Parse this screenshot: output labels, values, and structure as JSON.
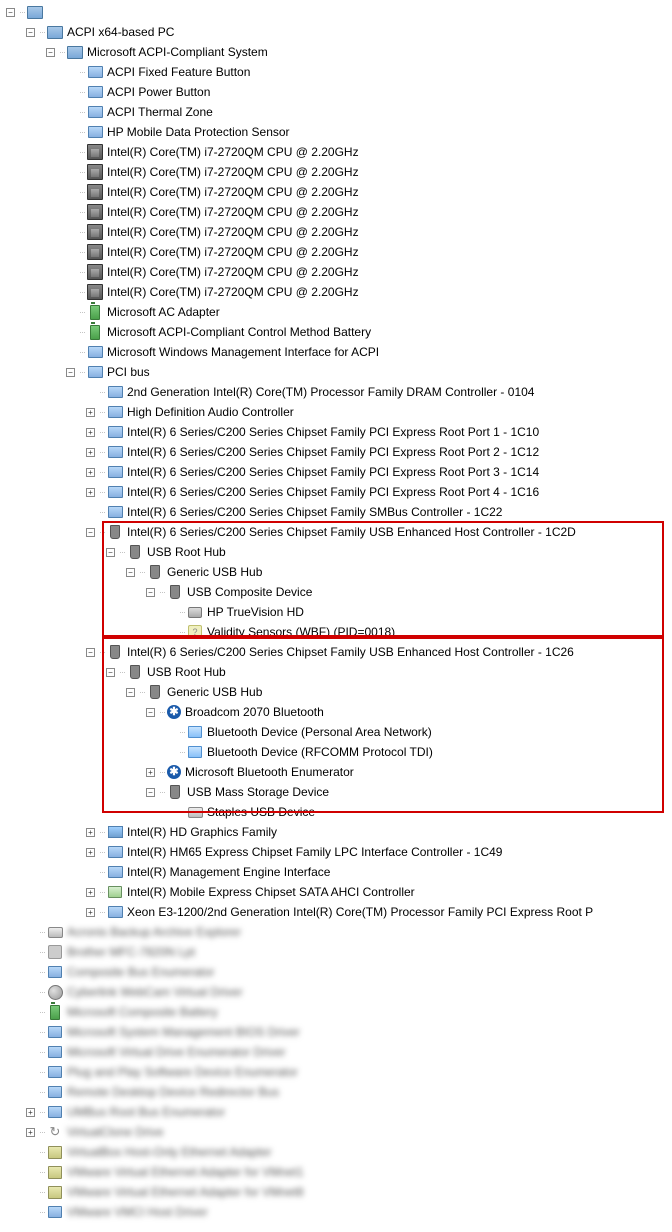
{
  "tree": [
    {
      "d": 0,
      "t": "minus",
      "i": "computer",
      "k": "root",
      "txt": "",
      "blur": true
    },
    {
      "d": 1,
      "t": "minus",
      "i": "computer",
      "k": "acpi-pc",
      "txt": "ACPI x64-based PC"
    },
    {
      "d": 2,
      "t": "minus",
      "i": "computer",
      "k": "ms-acpi",
      "txt": "Microsoft ACPI-Compliant System"
    },
    {
      "d": 3,
      "t": "",
      "i": "monitor",
      "k": "fixed-btn",
      "txt": "ACPI Fixed Feature Button"
    },
    {
      "d": 3,
      "t": "",
      "i": "monitor",
      "k": "power-btn",
      "txt": "ACPI Power Button"
    },
    {
      "d": 3,
      "t": "",
      "i": "monitor",
      "k": "thermal",
      "txt": "ACPI Thermal Zone"
    },
    {
      "d": 3,
      "t": "",
      "i": "monitor",
      "k": "hp-sensor",
      "txt": "HP Mobile Data Protection Sensor"
    },
    {
      "d": 3,
      "t": "",
      "i": "cpu",
      "k": "cpu0",
      "txt": "Intel(R) Core(TM) i7-2720QM CPU @ 2.20GHz"
    },
    {
      "d": 3,
      "t": "",
      "i": "cpu",
      "k": "cpu1",
      "txt": "Intel(R) Core(TM) i7-2720QM CPU @ 2.20GHz"
    },
    {
      "d": 3,
      "t": "",
      "i": "cpu",
      "k": "cpu2",
      "txt": "Intel(R) Core(TM) i7-2720QM CPU @ 2.20GHz"
    },
    {
      "d": 3,
      "t": "",
      "i": "cpu",
      "k": "cpu3",
      "txt": "Intel(R) Core(TM) i7-2720QM CPU @ 2.20GHz"
    },
    {
      "d": 3,
      "t": "",
      "i": "cpu",
      "k": "cpu4",
      "txt": "Intel(R) Core(TM) i7-2720QM CPU @ 2.20GHz"
    },
    {
      "d": 3,
      "t": "",
      "i": "cpu",
      "k": "cpu5",
      "txt": "Intel(R) Core(TM) i7-2720QM CPU @ 2.20GHz"
    },
    {
      "d": 3,
      "t": "",
      "i": "cpu",
      "k": "cpu6",
      "txt": "Intel(R) Core(TM) i7-2720QM CPU @ 2.20GHz"
    },
    {
      "d": 3,
      "t": "",
      "i": "cpu",
      "k": "cpu7",
      "txt": "Intel(R) Core(TM) i7-2720QM CPU @ 2.20GHz"
    },
    {
      "d": 3,
      "t": "",
      "i": "battery",
      "k": "ac-adapter",
      "txt": "Microsoft AC Adapter"
    },
    {
      "d": 3,
      "t": "",
      "i": "battery",
      "k": "ctrl-battery",
      "txt": "Microsoft ACPI-Compliant Control Method Battery"
    },
    {
      "d": 3,
      "t": "",
      "i": "monitor",
      "k": "wmi-acpi",
      "txt": "Microsoft Windows Management Interface for ACPI"
    },
    {
      "d": 3,
      "t": "minus",
      "i": "monitor",
      "k": "pci-bus",
      "txt": "PCI bus"
    },
    {
      "d": 4,
      "t": "",
      "i": "monitor",
      "k": "dram",
      "txt": "2nd Generation Intel(R) Core(TM) Processor Family DRAM Controller - 0104"
    },
    {
      "d": 4,
      "t": "plus",
      "i": "monitor",
      "k": "hd-audio",
      "txt": "High Definition Audio Controller"
    },
    {
      "d": 4,
      "t": "plus",
      "i": "monitor",
      "k": "pci-1",
      "txt": "Intel(R) 6 Series/C200 Series Chipset Family PCI Express Root Port 1 - 1C10"
    },
    {
      "d": 4,
      "t": "plus",
      "i": "monitor",
      "k": "pci-2",
      "txt": "Intel(R) 6 Series/C200 Series Chipset Family PCI Express Root Port 2 - 1C12"
    },
    {
      "d": 4,
      "t": "plus",
      "i": "monitor",
      "k": "pci-3",
      "txt": "Intel(R) 6 Series/C200 Series Chipset Family PCI Express Root Port 3 - 1C14"
    },
    {
      "d": 4,
      "t": "plus",
      "i": "monitor",
      "k": "pci-4",
      "txt": "Intel(R) 6 Series/C200 Series Chipset Family PCI Express Root Port 4 - 1C16"
    },
    {
      "d": 4,
      "t": "",
      "i": "monitor",
      "k": "smbus",
      "txt": "Intel(R) 6 Series/C200 Series Chipset Family SMBus Controller - 1C22"
    },
    {
      "d": 4,
      "t": "minus",
      "i": "usb",
      "k": "usb-host-1c2d",
      "txt": "Intel(R) 6 Series/C200 Series Chipset Family USB Enhanced Host Controller - 1C2D"
    },
    {
      "d": 5,
      "t": "minus",
      "i": "usb",
      "k": "usb-root-1",
      "txt": "USB Root Hub"
    },
    {
      "d": 6,
      "t": "minus",
      "i": "usb",
      "k": "generic-hub-1",
      "txt": "Generic USB Hub"
    },
    {
      "d": 7,
      "t": "minus",
      "i": "usb",
      "k": "usb-composite",
      "txt": "USB Composite Device"
    },
    {
      "d": 8,
      "t": "",
      "i": "cam",
      "k": "truevision",
      "txt": "HP TrueVision HD"
    },
    {
      "d": 8,
      "t": "",
      "i": "unknown",
      "k": "validity",
      "txt": "Validity Sensors (WBF) (PID=0018)"
    },
    {
      "d": 4,
      "t": "minus",
      "i": "usb",
      "k": "usb-host-1c26",
      "txt": "Intel(R) 6 Series/C200 Series Chipset Family USB Enhanced Host Controller - 1C26"
    },
    {
      "d": 5,
      "t": "minus",
      "i": "usb",
      "k": "usb-root-2",
      "txt": "USB Root Hub"
    },
    {
      "d": 6,
      "t": "minus",
      "i": "usb",
      "k": "generic-hub-2",
      "txt": "Generic USB Hub"
    },
    {
      "d": 7,
      "t": "minus",
      "i": "bluetooth",
      "k": "broadcom",
      "txt": "Broadcom 2070 Bluetooth"
    },
    {
      "d": 8,
      "t": "",
      "i": "btdev",
      "k": "bt-pan",
      "txt": "Bluetooth Device (Personal Area Network)"
    },
    {
      "d": 8,
      "t": "",
      "i": "btdev",
      "k": "bt-rfcomm",
      "txt": "Bluetooth Device (RFCOMM Protocol TDI)"
    },
    {
      "d": 7,
      "t": "plus",
      "i": "bluetooth",
      "k": "bt-enum",
      "txt": "Microsoft Bluetooth Enumerator"
    },
    {
      "d": 7,
      "t": "minus",
      "i": "usb",
      "k": "usb-mass",
      "txt": "USB Mass Storage Device"
    },
    {
      "d": 8,
      "t": "",
      "i": "disk",
      "k": "staples",
      "txt": "Staples USB Device"
    },
    {
      "d": 4,
      "t": "plus",
      "i": "display",
      "k": "hd-gfx",
      "txt": "Intel(R) HD Graphics Family"
    },
    {
      "d": 4,
      "t": "plus",
      "i": "monitor",
      "k": "lpc",
      "txt": "Intel(R) HM65 Express Chipset Family LPC Interface Controller - 1C49"
    },
    {
      "d": 4,
      "t": "",
      "i": "monitor",
      "k": "mei",
      "txt": "Intel(R) Management Engine Interface"
    },
    {
      "d": 4,
      "t": "plus",
      "i": "chip",
      "k": "sata",
      "txt": "Intel(R) Mobile Express Chipset SATA AHCI Controller"
    },
    {
      "d": 4,
      "t": "plus",
      "i": "monitor",
      "k": "xeon",
      "txt": "Xeon E3-1200/2nd Generation Intel(R) Core(TM) Processor Family PCI Express Root P"
    },
    {
      "d": 1,
      "t": "",
      "i": "disk",
      "k": "b1",
      "txt": "Acronis Backup Archive Explorer",
      "blur": true
    },
    {
      "d": 1,
      "t": "",
      "i": "gray",
      "k": "b2",
      "txt": "Brother MFC-7820N Lpt",
      "blur": true
    },
    {
      "d": 1,
      "t": "",
      "i": "sys",
      "k": "b3",
      "txt": "Composite Bus Enumerator",
      "blur": true
    },
    {
      "d": 1,
      "t": "",
      "i": "globe",
      "k": "b4",
      "txt": "Cyberlink WebCam Virtual Driver",
      "blur": true
    },
    {
      "d": 1,
      "t": "",
      "i": "battery",
      "k": "b5",
      "txt": "Microsoft Composite Battery",
      "blur": true
    },
    {
      "d": 1,
      "t": "",
      "i": "sys",
      "k": "b6",
      "txt": "Microsoft System Management BIOS Driver",
      "blur": true
    },
    {
      "d": 1,
      "t": "",
      "i": "sys",
      "k": "b7",
      "txt": "Microsoft Virtual Drive Enumerator Driver",
      "blur": true
    },
    {
      "d": 1,
      "t": "",
      "i": "sys",
      "k": "b8",
      "txt": "Plug and Play Software Device Enumerator",
      "blur": true
    },
    {
      "d": 1,
      "t": "",
      "i": "sys",
      "k": "b9",
      "txt": "Remote Desktop Device Redirector Bus",
      "blur": true
    },
    {
      "d": 1,
      "t": "plus",
      "i": "sys",
      "k": "b10",
      "txt": "UMBus Root Bus Enumerator",
      "blur": true
    },
    {
      "d": 1,
      "t": "plus",
      "i": "virt",
      "k": "b11",
      "txt": "VirtualClone Drive",
      "blur": true
    },
    {
      "d": 1,
      "t": "",
      "i": "net",
      "k": "b12",
      "txt": "VirtualBox Host-Only Ethernet Adapter",
      "blur": true
    },
    {
      "d": 1,
      "t": "",
      "i": "net",
      "k": "b13",
      "txt": "VMware Virtual Ethernet Adapter for VMnet1",
      "blur": true
    },
    {
      "d": 1,
      "t": "",
      "i": "net",
      "k": "b14",
      "txt": "VMware Virtual Ethernet Adapter for VMnet8",
      "blur": true
    },
    {
      "d": 1,
      "t": "",
      "i": "sys",
      "k": "b15",
      "txt": "VMware VMCI Host Driver",
      "blur": true
    }
  ]
}
